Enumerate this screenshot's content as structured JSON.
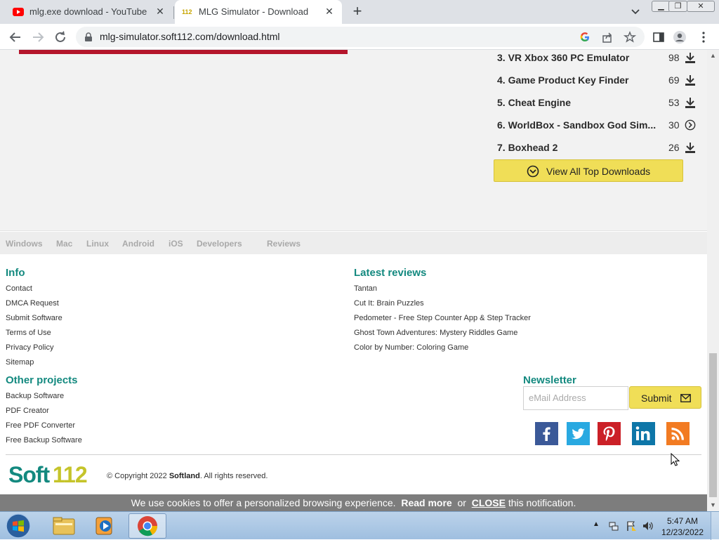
{
  "browser": {
    "tabs": [
      {
        "title": "mlg.exe download - YouTube",
        "close": "✕"
      },
      {
        "title": "MLG Simulator - Download",
        "favicon_text": "112",
        "close": "✕"
      }
    ],
    "new_tab": "+",
    "url": "mlg-simulator.soft112.com/download.html"
  },
  "top_downloads": [
    {
      "name": "3. VR Xbox 360 PC Emulator",
      "count": "98",
      "icon": "download-icon"
    },
    {
      "name": "4. Game Product Key Finder",
      "count": "69",
      "icon": "download-icon"
    },
    {
      "name": "5. Cheat Engine",
      "count": "53",
      "icon": "download-icon"
    },
    {
      "name": "6. WorldBox - Sandbox God Sim...",
      "count": "30",
      "icon": "arrow-circle-icon"
    },
    {
      "name": "7. Boxhead 2",
      "count": "26",
      "icon": "download-icon"
    }
  ],
  "view_all_label": "View All Top Downloads",
  "platforms": [
    "Windows",
    "Mac",
    "Linux",
    "Android",
    "iOS",
    "Developers",
    "Reviews"
  ],
  "footer": {
    "info_heading": "Info",
    "info_links": [
      "Contact",
      "DMCA Request",
      "Submit Software",
      "Terms of Use",
      "Privacy Policy",
      "Sitemap"
    ],
    "reviews_heading": "Latest reviews",
    "reviews_links": [
      "Tantan",
      "Cut It: Brain Puzzles",
      "Pedometer - Free Step Counter App & Step Tracker",
      "Ghost Town Adventures: Mystery Riddles Game",
      "Color by Number: Coloring Game"
    ],
    "projects_heading": "Other projects",
    "projects_links": [
      "Backup Software",
      "PDF Creator",
      "Free PDF Converter",
      "Free Backup Software"
    ],
    "newsletter_heading": "Newsletter",
    "email_placeholder": "eMail Address",
    "submit_label": "Submit",
    "social": [
      "facebook-icon",
      "twitter-icon",
      "pinterest-icon",
      "linkedin-icon",
      "rss-icon"
    ],
    "logo_text": "Soft112",
    "copyright_prefix": "© Copyright 2022",
    "copyright_company": "Softland",
    "copyright_suffix": ". All rights reserved."
  },
  "cookie": {
    "text": "We use cookies to offer a personalized browsing experience.",
    "read_more": "Read more",
    "or": "or",
    "close": "CLOSE",
    "suffix": "this notification."
  },
  "taskbar": {
    "time": "5:47 AM",
    "date": "12/23/2022"
  },
  "colors": {
    "accent_teal": "#13897f",
    "button_yellow": "#f0de57",
    "youtube_red": "#ff0000"
  }
}
